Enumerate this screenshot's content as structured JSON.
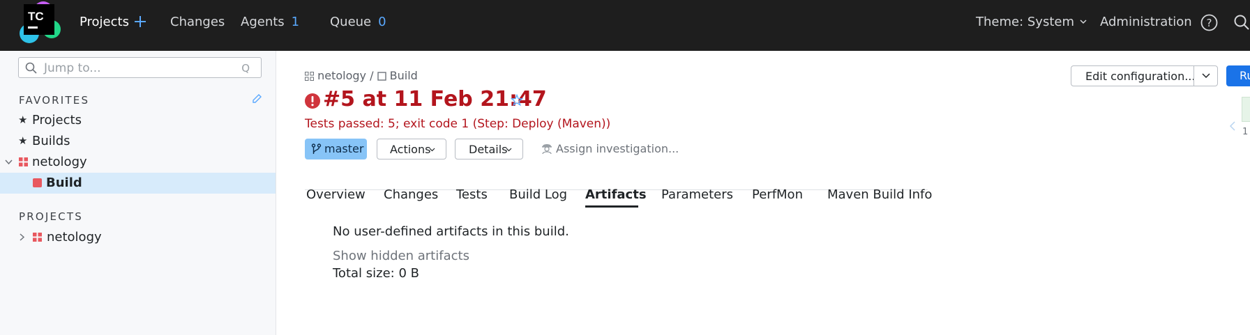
{
  "header": {
    "logo_text": "TC",
    "nav": [
      {
        "label": "Projects"
      },
      {
        "label": "Changes"
      },
      {
        "label": "Agents",
        "count": "1"
      },
      {
        "label": "Queue",
        "count": "0"
      }
    ],
    "theme_label": "Theme: System",
    "admin_label": "Administration",
    "icons": [
      "plus-icon",
      "help-icon",
      "search-icon"
    ]
  },
  "sidebar": {
    "search_placeholder": "Jump to...",
    "search_shortcut": "Q",
    "favorites_title": "FAVORITES",
    "favorites": [
      {
        "label": "Projects"
      },
      {
        "label": "Builds"
      },
      {
        "label": "netology"
      },
      {
        "label": "Build"
      }
    ],
    "projects_title": "PROJECTS",
    "projects": [
      {
        "label": "netology"
      }
    ]
  },
  "main": {
    "breadcrumb": {
      "project": "netology",
      "sep": "/",
      "build": "Build"
    },
    "title": "#5 at 11 Feb 21:47",
    "status": "Tests passed: 5; exit code 1 (Step: Deploy (Maven))",
    "branch": "master",
    "actions_label": "Actions",
    "details_label": "Details",
    "assign_label": "Assign investigation...",
    "tabs": [
      {
        "label": "Overview"
      },
      {
        "label": "Changes"
      },
      {
        "label": "Tests"
      },
      {
        "label": "Build Log"
      },
      {
        "label": "Artifacts"
      },
      {
        "label": "Parameters"
      },
      {
        "label": "PerfMon"
      },
      {
        "label": "Maven Build Info"
      }
    ],
    "active_tab": "Artifacts",
    "artifacts": {
      "message": "No user-defined artifacts in this build.",
      "hidden_link": "Show hidden artifacts",
      "total_size": "Total size: 0 B"
    },
    "edit_config_label": "Edit configuration...",
    "run_label": "Ru",
    "mini_value": "1"
  },
  "colors": {
    "topbar": "#1e1e1e",
    "accent_blue": "#1a73e8",
    "error_red": "#b3151d",
    "branch_chip": "#87c4f7",
    "selected_row": "#d7ebfb"
  }
}
